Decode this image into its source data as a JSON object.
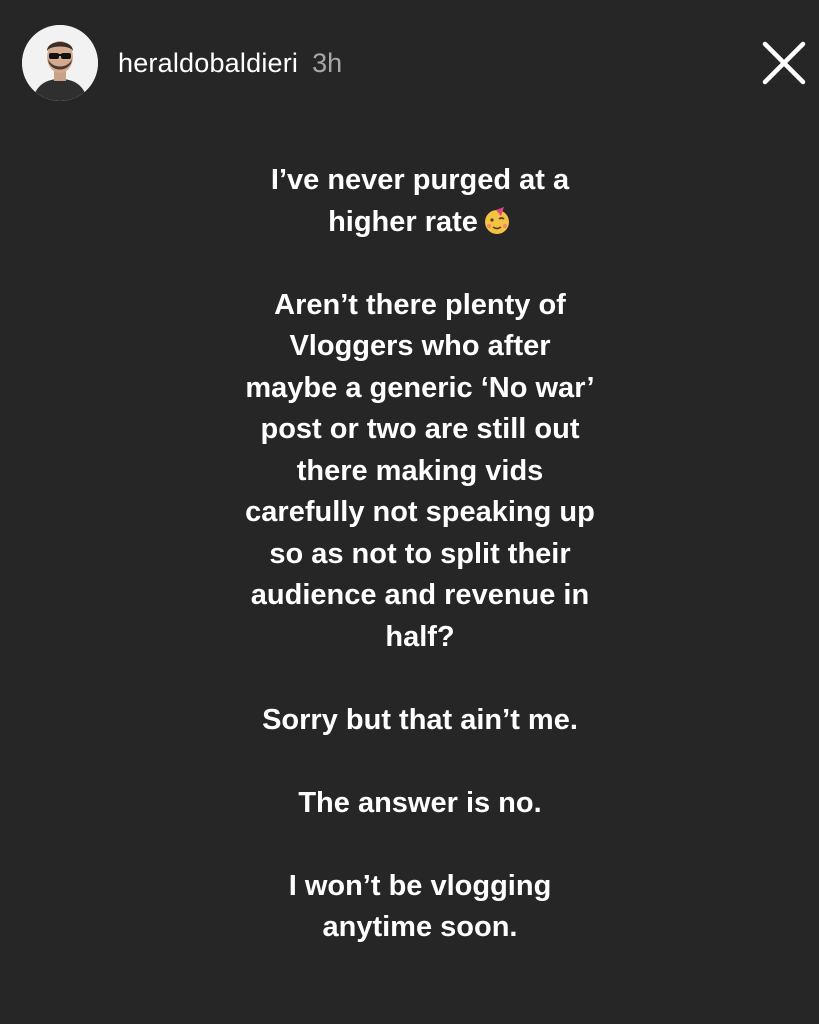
{
  "story": {
    "username": "heraldobaldieri",
    "timestamp": "3h",
    "avatar_icon": "user-avatar-icon",
    "close_icon": "close-icon",
    "emoji_icon": "partying-face-emoji-icon",
    "paragraphs": [
      "I’ve never purged at a\nhigher rate",
      "Aren’t there plenty of\nVloggers who after\nmaybe a generic ‘No war’\npost or two are still out\nthere making vids\ncarefully not speaking up\nso as not to split their\naudience and revenue in\nhalf?",
      "Sorry but that ain’t me.",
      "The answer is no.",
      "I won’t be vlogging\nanytime soon."
    ]
  },
  "colors": {
    "background": "#262626",
    "text": "#ffffff",
    "timestamp": "#a8a8a8"
  }
}
